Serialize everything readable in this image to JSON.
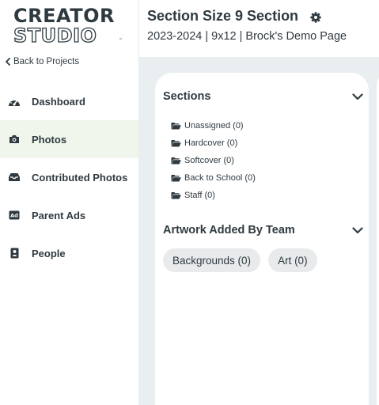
{
  "brand": {
    "logo_line1": "CREATOR",
    "logo_line2": "STUDIO",
    "logo_mark": "™",
    "text_color": "#2f3a40"
  },
  "sidebar": {
    "back_label": "Back to Projects",
    "back_icon": "chevron-left-icon",
    "active_bg": "#f1f6ec",
    "items": [
      {
        "label": "Dashboard",
        "icon": "speedometer-icon",
        "active": false
      },
      {
        "label": "Photos",
        "icon": "camera-icon",
        "active": true
      },
      {
        "label": "Contributed Photos",
        "icon": "inbox-tray-icon",
        "active": false
      },
      {
        "label": "Parent Ads",
        "icon": "ad-badge-icon",
        "active": false,
        "icon_text": "Ad"
      },
      {
        "label": "People",
        "icon": "contact-badge-icon",
        "active": false
      }
    ]
  },
  "header": {
    "title": "Section Size 9 Section",
    "settings_icon": "gear-icon",
    "subtitle": "2023-2024 | 9x12 | Brock's Demo Page"
  },
  "main": {
    "background": "#e9eef1",
    "sections_panel": {
      "title": "Sections",
      "toggle_icon": "chevron-down-icon",
      "folders": [
        {
          "label": "Unassigned (0)",
          "icon": "folder-open-icon"
        },
        {
          "label": "Hardcover (0)",
          "icon": "folder-open-icon"
        },
        {
          "label": "Softcover (0)",
          "icon": "folder-open-icon"
        },
        {
          "label": "Back to School (0)",
          "icon": "folder-open-icon"
        },
        {
          "label": "Staff (0)",
          "icon": "folder-open-icon"
        }
      ]
    },
    "artwork_panel": {
      "title": "Artwork Added By Team",
      "toggle_icon": "chevron-down-icon",
      "chips": [
        {
          "label": "Backgrounds (0)"
        },
        {
          "label": "Art (0)"
        }
      ],
      "chip_bg": "#e8eaeb"
    }
  }
}
